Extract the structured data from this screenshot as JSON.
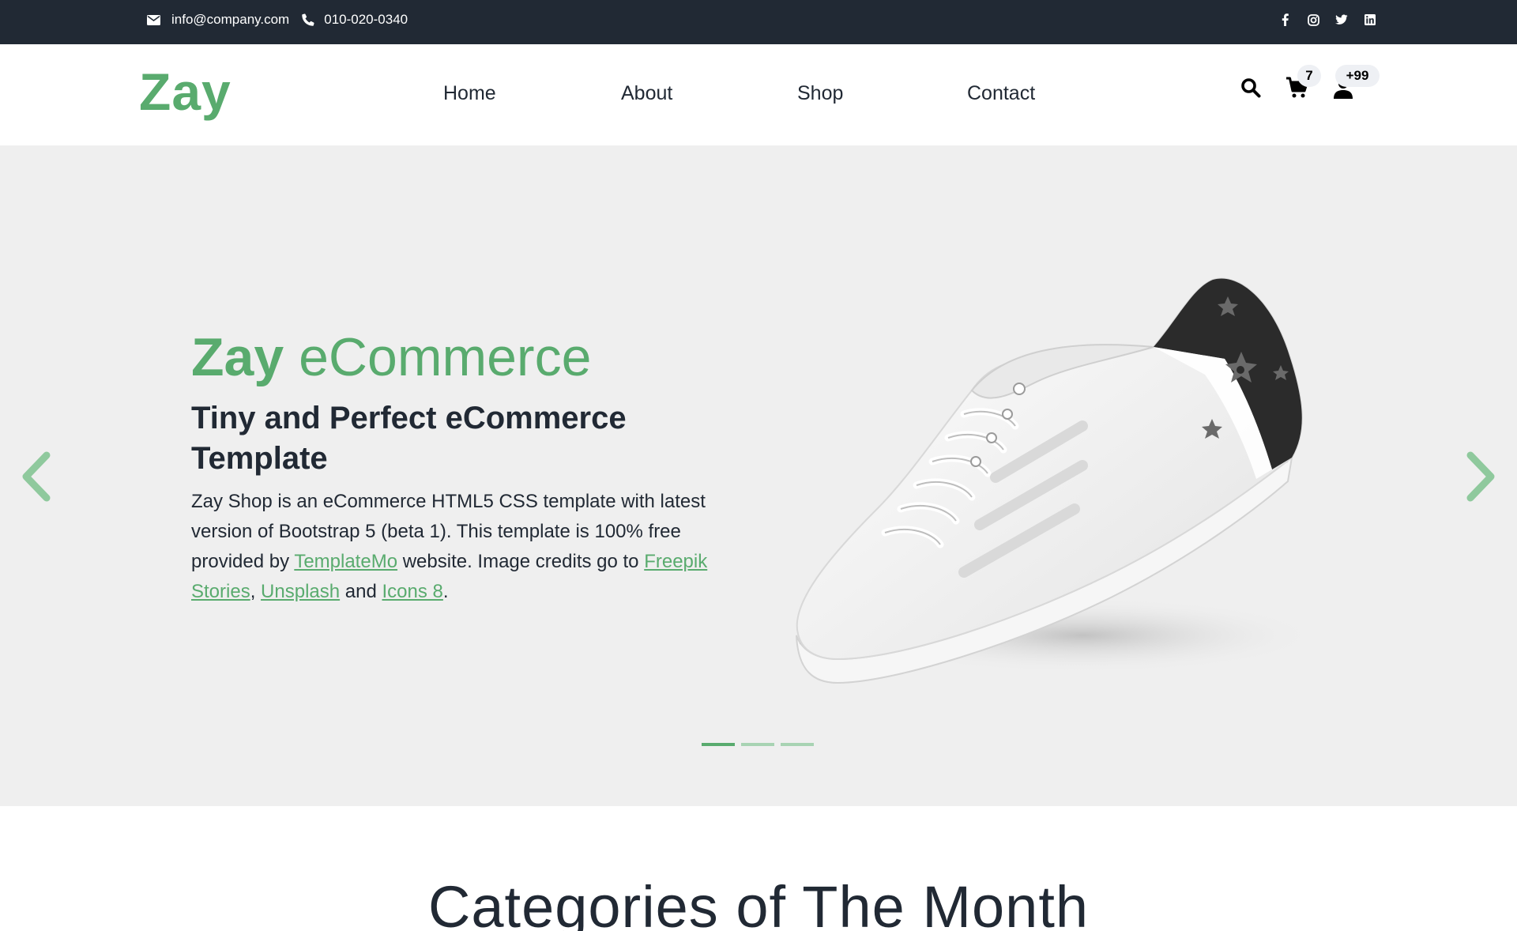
{
  "topbar": {
    "email": "info@company.com",
    "phone": "010-020-0340",
    "social_icons": [
      "facebook-icon",
      "instagram-icon",
      "twitter-icon",
      "linkedin-icon"
    ]
  },
  "header": {
    "logo": "Zay",
    "nav": [
      "Home",
      "About",
      "Shop",
      "Contact"
    ],
    "cart_count": "7",
    "user_count": "+99",
    "icons": [
      "search-icon",
      "cart-icon",
      "user-icon"
    ]
  },
  "hero": {
    "title_bold": "Zay",
    "title_light": " eCommerce",
    "subtitle": "Tiny and Perfect eCommerce Template",
    "text_1": "Zay Shop is an eCommerce HTML5 CSS template with latest version of Bootstrap 5 (beta 1). This template is 100% free provided by ",
    "link_templatemo": "TemplateMo",
    "text_2": " website. Image credits go to ",
    "link_freepik": "Freepik Stories",
    "text_3": ", ",
    "link_unsplash": "Unsplash",
    "text_4": " and ",
    "link_icons8": "Icons 8",
    "text_5": ".",
    "slides_total": 3,
    "slide_active": 1
  },
  "categories": {
    "title": "Categories of The Month"
  },
  "colors": {
    "brand": "#59ab6e",
    "dark": "#212934",
    "hero_bg": "#efefef"
  }
}
